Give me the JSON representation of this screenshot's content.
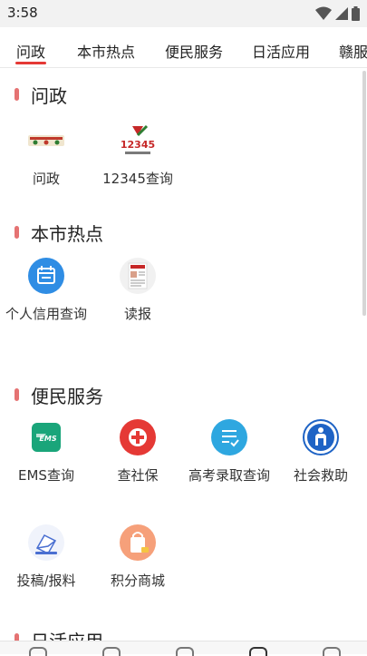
{
  "status_bar": {
    "time": "3:58"
  },
  "tabs": [
    {
      "label": "问政",
      "active": true
    },
    {
      "label": "本市热点",
      "active": false
    },
    {
      "label": "便民服务",
      "active": false
    },
    {
      "label": "日活应用",
      "active": false
    },
    {
      "label": "赣服",
      "active": false
    }
  ],
  "sections": [
    {
      "title": "问政",
      "items": [
        {
          "label": "问政",
          "icon": "banner-image-icon"
        },
        {
          "label": "12345查询",
          "icon": "hotline-12345-logo"
        }
      ]
    },
    {
      "title": "本市热点",
      "items": [
        {
          "label": "个人信用查询",
          "icon": "credit-calendar-icon"
        },
        {
          "label": "读报",
          "icon": "newspaper-icon"
        }
      ]
    },
    {
      "title": "便民服务",
      "items": [
        {
          "label": "EMS查询",
          "icon": "ems-icon"
        },
        {
          "label": "查社保",
          "icon": "social-security-icon"
        },
        {
          "label": "高考录取查询",
          "icon": "exam-checklist-icon"
        },
        {
          "label": "社会救助",
          "icon": "social-relief-icon"
        },
        {
          "label": "投稿/报料",
          "icon": "submit-envelope-icon"
        },
        {
          "label": "积分商城",
          "icon": "points-shop-bag-icon"
        }
      ]
    },
    {
      "title": "日活应用",
      "items": []
    }
  ],
  "colors": {
    "accent": "#e53935",
    "section_marker": "#e57373",
    "ems_green": "#1aa57a",
    "social_red": "#e53935",
    "exam_blue": "#2ea7e0",
    "relief_blue": "#1e63c5",
    "credit_blue": "#2f8de4",
    "shop_orange": "#f6a07a"
  }
}
